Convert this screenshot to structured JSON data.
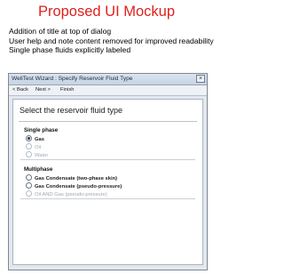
{
  "slide": {
    "title": "Proposed UI Mockup",
    "notes": [
      "Addition of title at top of dialog",
      "User help and note content removed for improved readability",
      "Single phase fluids explicitly labeled"
    ]
  },
  "dialog": {
    "title": "WellTest Wizard : Specify Reservoir Fluid Type",
    "close_label": "×",
    "toolbar": {
      "back_label": "< Back",
      "next_label": "Next >",
      "finish_label": "Finish"
    },
    "heading": "Select the reservoir fluid type",
    "single_phase": {
      "label": "Single phase",
      "options": [
        {
          "label": "Gas",
          "selected": true,
          "enabled": true
        },
        {
          "label": "Oil",
          "selected": false,
          "enabled": false
        },
        {
          "label": "Water",
          "selected": false,
          "enabled": false
        }
      ]
    },
    "multiphase": {
      "label": "Multiphase",
      "options": [
        {
          "label": "Gas Condensate (two-phase skin)",
          "selected": false,
          "enabled": true
        },
        {
          "label": "Gas Condensate (pseudo-pressure)",
          "selected": false,
          "enabled": true
        },
        {
          "label": "Oil AND Gas (pseudo-pressure)",
          "selected": false,
          "enabled": false
        }
      ]
    }
  }
}
